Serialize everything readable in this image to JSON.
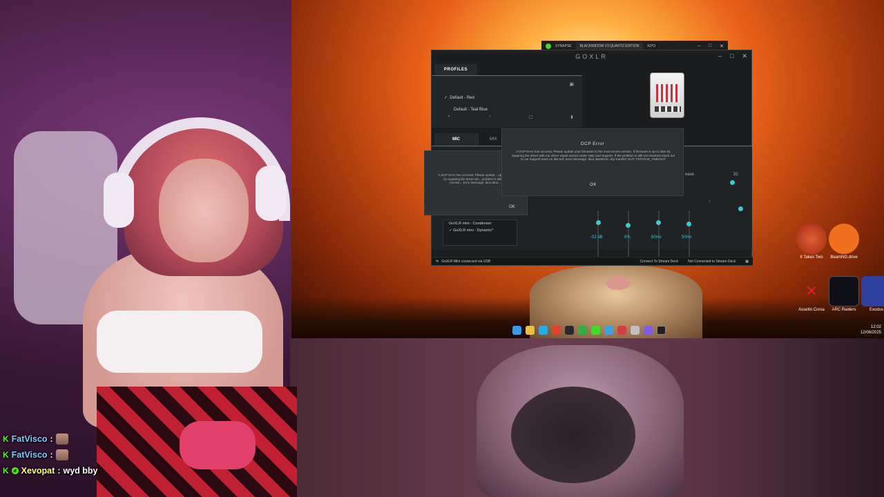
{
  "desktop": {
    "shortcuts": [
      {
        "label": "It Takes Two"
      },
      {
        "label": "BeamNG.drive"
      },
      {
        "label": "Assetto Corsa"
      },
      {
        "label": "ARC Raiders"
      },
      {
        "label": "Exodus"
      }
    ],
    "clock": {
      "time": "12:02",
      "date": "12/08/2025"
    }
  },
  "synapse": {
    "title": "SYNAPSE",
    "tab": "BLACKWIDOW V3 QUARTZ EDITION",
    "app2": "KIYO"
  },
  "goxlr": {
    "logo": "GOXLR",
    "profiles_tab": "PROFILES",
    "profiles": [
      "Default - Red",
      "Default - Teal Blue"
    ],
    "tabs": {
      "mic": "MIC",
      "mix": "MIX"
    },
    "mini_profiles": [
      "GoXLR mini - Condenser",
      "GoXLR mini - Dynamic*"
    ],
    "values": [
      "-52 dB",
      "6%",
      "60ms",
      "50ms"
    ],
    "partial_text": {
      "please": "ease",
      "num": "32"
    },
    "status": {
      "connection": "GoXLR Mini connected via USB",
      "stream_deck_link": "Connect To Stream Deck",
      "stream_deck_status": "Not Connected to Stream Deck"
    }
  },
  "error_dialog": {
    "title": "DCP Error",
    "message": "A DCP Error has occured. Please update your firmware to the most recent version. If firmware is up to date try repairing the driver with our driver repair wizard under Help and Support. If the problem is still not resolved reach out to our support team on discord. Error Message: dica::BusError: dcp transfer OUT: TSTATUS_TIMEOUT",
    "ok_label": "OK"
  },
  "error_dialog_back": {
    "message": "A DCP Error has occured. Please update... up to date try repairing the driver wit... problem is still not resolve... Error Message: dica::Bus...",
    "ok_label": "OK"
  },
  "chat": [
    {
      "user": "FatVisco",
      "message": ""
    },
    {
      "user": "FatVisco",
      "message": ""
    },
    {
      "user": "Xevopat",
      "message": "wyd bby"
    }
  ],
  "colors": {
    "accent_teal": "#3ec8d0",
    "chat_badge": "#53fc18",
    "goxlr_bg": "#1b1d1e"
  }
}
